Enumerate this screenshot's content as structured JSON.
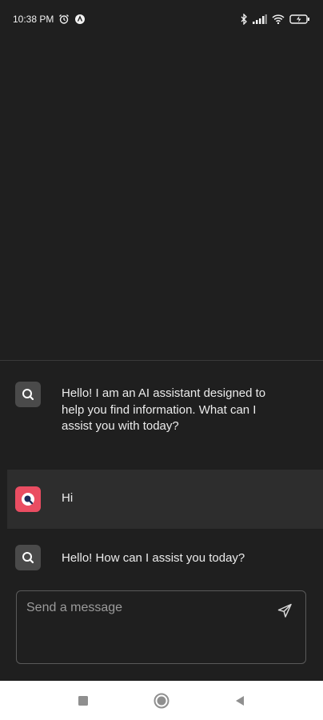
{
  "status_bar": {
    "time": "10:38 PM",
    "left_icons": [
      "alarm-icon",
      "app-notification-icon"
    ],
    "right_icons": [
      "bluetooth-icon",
      "signal-icon",
      "wifi-icon",
      "battery-icon"
    ]
  },
  "messages": [
    {
      "sender": "assistant",
      "text": "Hello! I am an AI assistant designed to help you find information. What can I assist you with today?"
    },
    {
      "sender": "user",
      "text": "Hi"
    },
    {
      "sender": "assistant",
      "text": "Hello! How can I assist you today?"
    }
  ],
  "composer": {
    "placeholder": "Send a message",
    "value": "",
    "send_icon": "send-icon"
  },
  "nav_bar": {
    "icons": [
      "recent-apps-icon",
      "home-icon",
      "back-icon"
    ]
  },
  "colors": {
    "background": "#1f1f1f",
    "highlight_row": "#2d2d2d",
    "user_avatar": "#ea4d62",
    "bot_avatar": "#4a4a4a",
    "cursor": "#29c4cf"
  }
}
